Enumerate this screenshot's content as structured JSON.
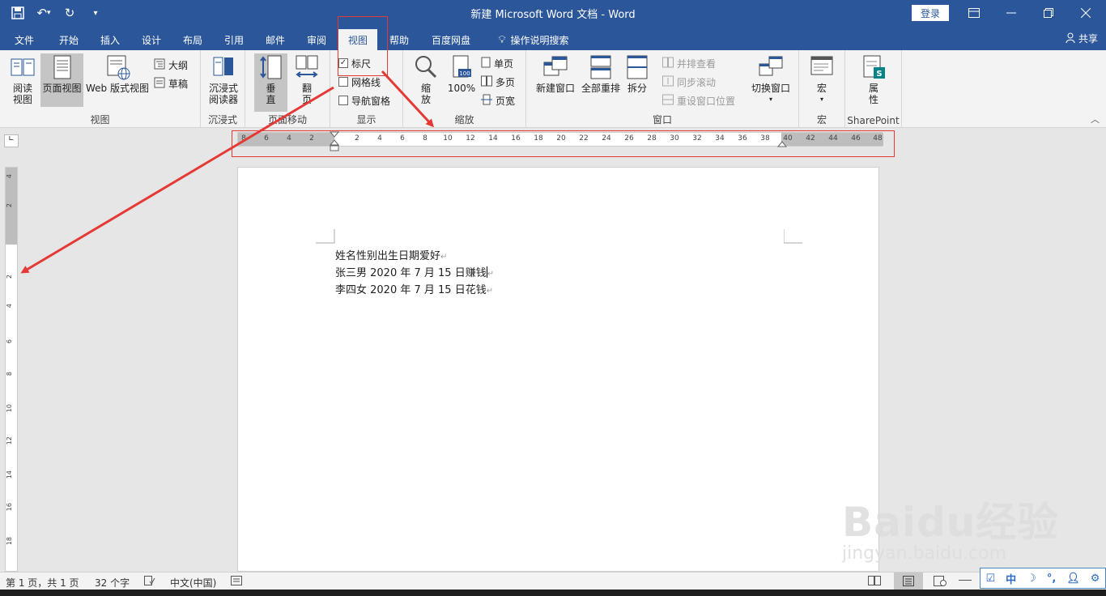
{
  "titlebar": {
    "title": "新建 Microsoft Word 文档  -  Word",
    "login": "登录",
    "qat_more": "▾"
  },
  "tabs": [
    "文件",
    "开始",
    "插入",
    "设计",
    "布局",
    "引用",
    "邮件",
    "审阅",
    "视图",
    "帮助",
    "百度网盘",
    "操作说明搜索"
  ],
  "active_tab": "视图",
  "share": "共享",
  "ribbon": {
    "views": {
      "label": "视图",
      "read": "阅读\n视图",
      "print": "页面视图",
      "web": "Web 版式视图",
      "outline": "大纲",
      "draft": "草稿"
    },
    "immersive": {
      "label": "沉浸式",
      "reader": "沉浸式\n阅读器"
    },
    "page_move": {
      "label": "页面移动",
      "vertical": "垂\n直",
      "flip": "翻\n页"
    },
    "show": {
      "label": "显示",
      "ruler": "标尺",
      "ruler_checked": true,
      "gridlines": "网格线",
      "nav": "导航窗格"
    },
    "zoom": {
      "label": "缩放",
      "zoom": "缩\n放",
      "percent": "100%",
      "single": "单页",
      "multi": "多页",
      "width": "页宽"
    },
    "window": {
      "label": "窗口",
      "new": "新建窗口",
      "arrange": "全部重排",
      "split": "拆分",
      "side": "并排查看",
      "sync": "同步滚动",
      "reset": "重设窗口位置",
      "switch": "切换窗口"
    },
    "macro": {
      "label": "宏",
      "macro": "宏"
    },
    "sharepoint": {
      "label": "SharePoint",
      "props": "属\n性"
    }
  },
  "ruler": {
    "left_ticks": [
      "8",
      "6",
      "4",
      "2"
    ],
    "ticks": [
      "2",
      "4",
      "6",
      "8",
      "10",
      "12",
      "14",
      "16",
      "18",
      "20",
      "22",
      "24",
      "26",
      "28",
      "30",
      "32",
      "34",
      "36",
      "38",
      "40",
      "42",
      "44",
      "46",
      "48"
    ],
    "vticks": [
      "4",
      "2",
      "",
      "2",
      "4",
      "6",
      "8",
      "10",
      "12",
      "14",
      "16",
      "18"
    ]
  },
  "document": {
    "lines": [
      "姓名性别出生日期爱好",
      "张三男 2020 年 7 月 15 日赚钱",
      "李四女 2020 年 7 月 15 日花钱"
    ],
    "para_mark": "↵"
  },
  "status": {
    "page": "第 1 页，共 1 页",
    "words": "32 个字",
    "lang": "中文(中国)"
  },
  "watermark": {
    "logo": "Baidu经验",
    "url": "jingyan.baidu.com"
  },
  "ime": {
    "mode": "中"
  }
}
